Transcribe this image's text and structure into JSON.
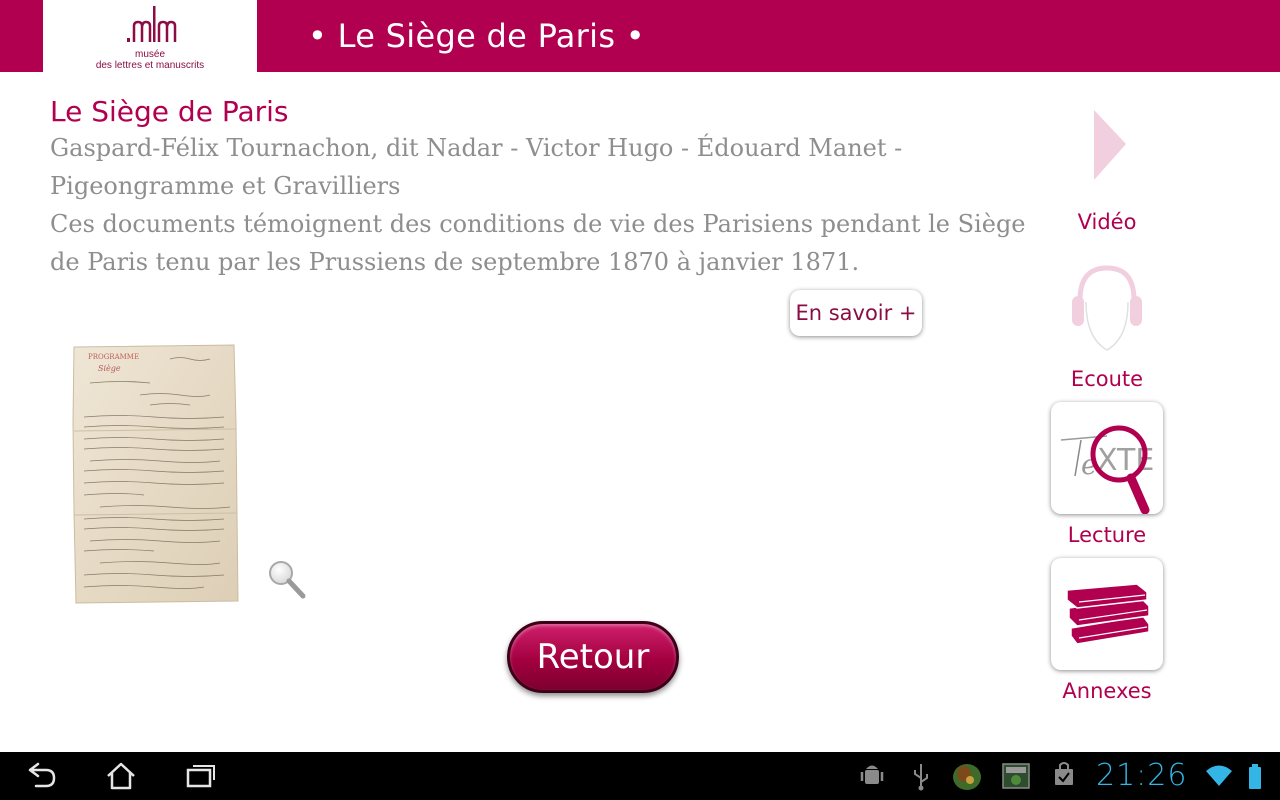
{
  "colors": {
    "brand": "#b1004f",
    "brand_dark": "#8a0e45",
    "body_text": "#8e8e8e",
    "clock": "#33b5e5"
  },
  "header": {
    "logo_mark": "mlm",
    "logo_line1": "musée",
    "logo_line2": "des lettres et manuscrits",
    "title": "• Le Siège de Paris •"
  },
  "main": {
    "title": "Le Siège de Paris",
    "authors_line1": "Gaspard-Félix Tournachon, dit Nadar - Victor Hugo - Édouard Manet -",
    "authors_line2": "Pigeongramme et Gravilliers",
    "description_line1": "Ces documents témoignent des conditions de vie des Parisiens pendant le Siège",
    "description_line2": "de Paris tenu par les Prussiens de septembre 1870 à janvier 1871.",
    "more_label": "En savoir +",
    "back_label": "Retour"
  },
  "side_nav": {
    "video": "Vidéo",
    "listen": "Ecoute",
    "read": "Lecture",
    "annexes": "Annexes"
  },
  "system_bar": {
    "clock": "21:26",
    "icons": [
      "back-icon",
      "home-icon",
      "recent-apps-icon",
      "android-debug-icon",
      "usb-icon",
      "app-notification-icon",
      "screenshot-icon",
      "store-icon",
      "wifi-icon",
      "battery-icon"
    ]
  }
}
